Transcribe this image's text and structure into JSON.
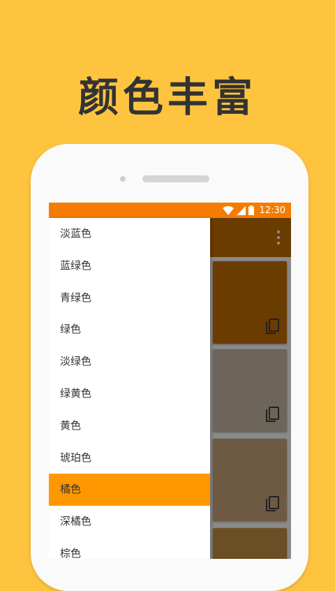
{
  "headline": "颜色丰富",
  "status_bar": {
    "time": "12:30"
  },
  "colors": {
    "background": "#FFC43F",
    "status_bar": "#F57C00",
    "selected_item": "#FF9800",
    "app_bar": "#6B3C00"
  },
  "drawer": {
    "items": [
      {
        "label": "淡蓝色"
      },
      {
        "label": "蓝绿色"
      },
      {
        "label": "青绿色"
      },
      {
        "label": "绿色"
      },
      {
        "label": "淡绿色"
      },
      {
        "label": "绿黄色"
      },
      {
        "label": "黄色"
      },
      {
        "label": "琥珀色"
      },
      {
        "label": "橘色"
      },
      {
        "label": "深橘色"
      },
      {
        "label": "棕色"
      }
    ],
    "selected_index": 8
  },
  "swatches": [
    {
      "color": "#6B3C00",
      "icon": "copy-icon"
    },
    {
      "color": "#6E655A",
      "icon": "copy-icon"
    },
    {
      "color": "#6E5A43",
      "icon": "copy-icon"
    },
    {
      "color": "#6B4E24",
      "icon": "copy-icon"
    }
  ]
}
